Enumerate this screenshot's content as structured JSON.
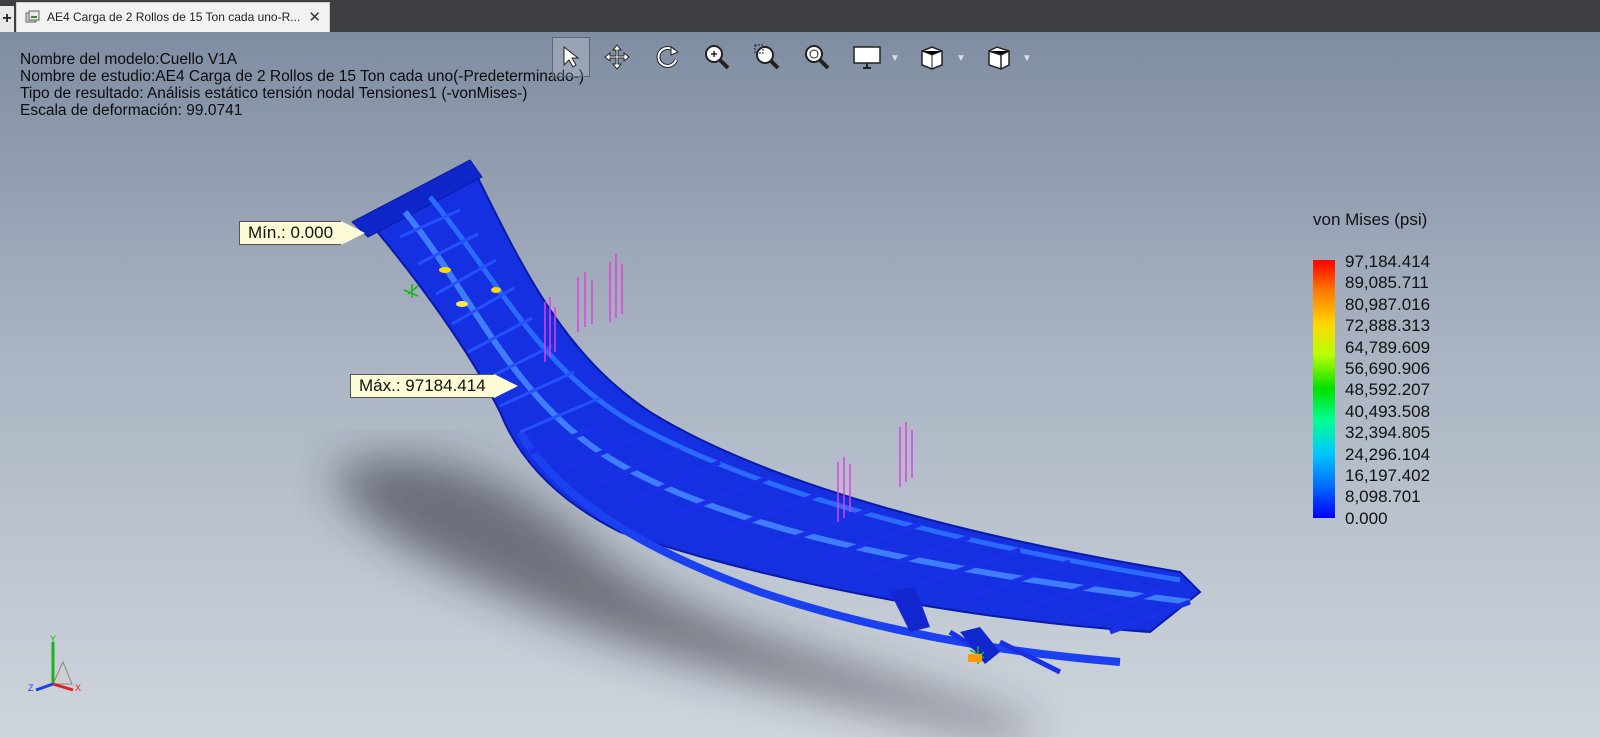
{
  "plus_label": "+",
  "tab": {
    "title": "AE4 Carga de 2 Rollos de 15 Ton cada uno-R...",
    "close": "✕"
  },
  "info": {
    "model": "Nombre del modelo:Cuello V1A",
    "study": "Nombre de estudio:AE4 Carga de 2 Rollos de 15 Ton cada uno(-Predeterminado-)",
    "result": "Tipo de resultado: Análisis estático tensión nodal Tensiones1 (-vonMises-)",
    "scale": "Escala de deformación: 99.0741"
  },
  "toolbar": [
    "select-icon",
    "pan-icon",
    "rotate-icon",
    "zoom-fit-icon",
    "zoom-area-icon",
    "zoom-in-icon",
    "display-icon",
    "view-orientation-icon",
    "display-style-icon"
  ],
  "callouts": {
    "min": "Mín.: 0.000",
    "max": "Máx.: 97184.414"
  },
  "legend": {
    "title": "von Mises (psi)",
    "values": [
      "97,184.414",
      "89,085.711",
      "80,987.016",
      "72,888.313",
      "64,789.609",
      "56,690.906",
      "48,592.207",
      "40,493.508",
      "32,394.805",
      "24,296.104",
      "16,197.402",
      "8,098.701",
      "0.000"
    ]
  },
  "triad": {
    "x": "X",
    "y": "Y",
    "z": "Z"
  },
  "colors": {
    "model": "#1430e0",
    "model_dark": "#0a1aa8",
    "stress_low": "#2a7aff",
    "load_arrows": "#e040e0"
  }
}
